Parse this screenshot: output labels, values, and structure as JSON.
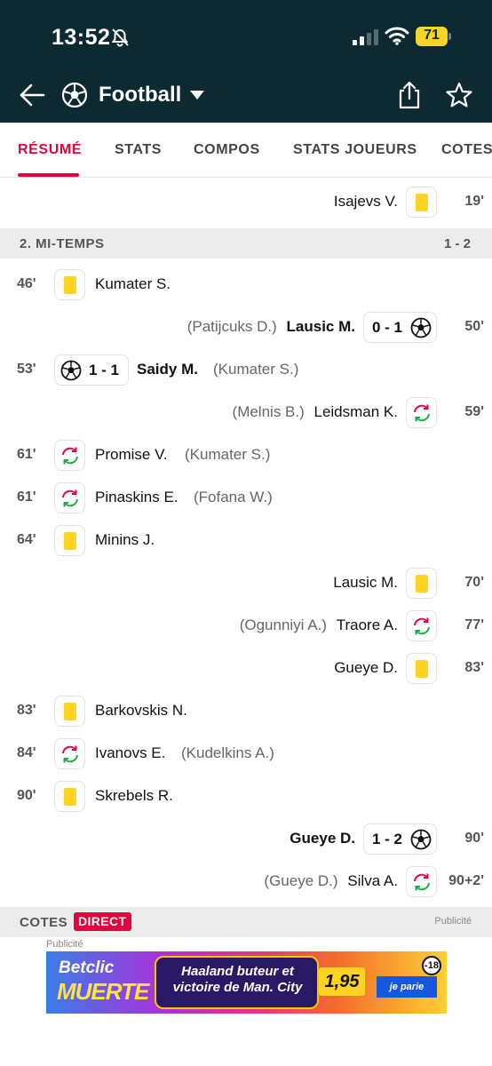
{
  "status_bar": {
    "time": "13:52",
    "battery": "71"
  },
  "header": {
    "title": "Football"
  },
  "tabs": [
    {
      "label": "RÉSUMÉ",
      "active": true
    },
    {
      "label": "STATS"
    },
    {
      "label": "COMPOS"
    },
    {
      "label": "STATS JOUEURS"
    },
    {
      "label": "COTES"
    }
  ],
  "first_half_tail": {
    "player": "Isajevs V.",
    "minute": "19'",
    "type": "yellow-card",
    "side": "away"
  },
  "second_half": {
    "title": "2. MI-TEMPS",
    "score": "1 - 2",
    "events": [
      {
        "minute": "46'",
        "side": "home",
        "type": "yellow-card",
        "player": "Kumater S."
      },
      {
        "minute": "50'",
        "side": "away",
        "type": "goal",
        "player": "Lausic M.",
        "assist": "(Patijcuks D.)",
        "score": "0 - 1"
      },
      {
        "minute": "53'",
        "side": "home",
        "type": "goal",
        "player": "Saidy M.",
        "assist": "(Kumater S.)",
        "score": "1 - 1"
      },
      {
        "minute": "59'",
        "side": "away",
        "type": "substitution",
        "player": "Leidsman K.",
        "assist": "(Melnis B.)"
      },
      {
        "minute": "61'",
        "side": "home",
        "type": "substitution",
        "player": "Promise V.",
        "assist": "(Kumater S.)"
      },
      {
        "minute": "61'",
        "side": "home",
        "type": "substitution",
        "player": "Pinaskins E.",
        "assist": "(Fofana W.)"
      },
      {
        "minute": "64'",
        "side": "home",
        "type": "yellow-card",
        "player": "Minins J."
      },
      {
        "minute": "70'",
        "side": "away",
        "type": "yellow-card",
        "player": "Lausic M."
      },
      {
        "minute": "77'",
        "side": "away",
        "type": "substitution",
        "player": "Traore A.",
        "assist": "(Ogunniyi A.)"
      },
      {
        "minute": "83'",
        "side": "away",
        "type": "yellow-card",
        "player": "Gueye D."
      },
      {
        "minute": "83'",
        "side": "home",
        "type": "yellow-card",
        "player": "Barkovskis N."
      },
      {
        "minute": "84'",
        "side": "home",
        "type": "substitution",
        "player": "Ivanovs E.",
        "assist": "(Kudelkins A.)"
      },
      {
        "minute": "90'",
        "side": "home",
        "type": "yellow-card",
        "player": "Skrebels R."
      },
      {
        "minute": "90'",
        "side": "away",
        "type": "goal",
        "player": "Gueye D.",
        "score": "1 - 2"
      },
      {
        "minute": "90+2'",
        "side": "away",
        "type": "substitution",
        "player": "Silva A.",
        "assist": "(Gueye D.)"
      }
    ]
  },
  "odds": {
    "title": "COTES",
    "badge": "DIRECT",
    "ad_label": "Publicité"
  },
  "ad": {
    "label": "Publicité",
    "brand_top": "Betclic",
    "brand_bottom": "MUERTE",
    "text": "Haaland buteur et victoire de Man. City",
    "odd": "1,95",
    "age": "-18",
    "cta": "je parie"
  },
  "colors": {
    "accent": "#e5003e",
    "header_bg": "#0d2a33",
    "card_yellow": "#ffd321"
  }
}
